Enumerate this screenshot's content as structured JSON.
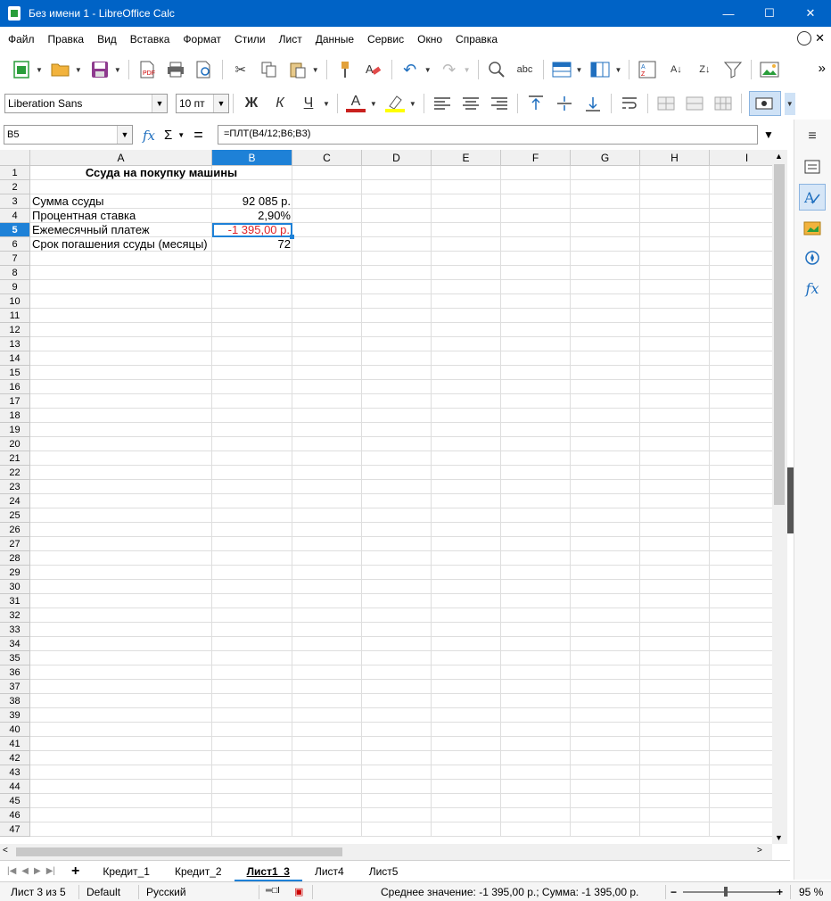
{
  "window": {
    "title": "Без имени 1 - LibreOffice Calc",
    "controls": [
      "—",
      "☐",
      "✕"
    ]
  },
  "menu": [
    "Файл",
    "Правка",
    "Вид",
    "Вставка",
    "Формат",
    "Стили",
    "Лист",
    "Данные",
    "Сервис",
    "Окно",
    "Справка"
  ],
  "format_toolbar": {
    "font_name": "Liberation Sans",
    "font_size": "10 пт",
    "bold": "Ж",
    "italic": "К",
    "underline": "Ч",
    "font_color_glyph": "A"
  },
  "formula_bar": {
    "cell_ref": "B5",
    "formula": "=ПЛТ(B4/12;B6;B3)"
  },
  "columns": [
    "A",
    "B",
    "C",
    "D",
    "E",
    "F",
    "G",
    "H",
    "I"
  ],
  "selected_column": "B",
  "selected_row": "5",
  "cells": {
    "a1": "Ссуда на покупку машины",
    "a3": "Сумма  ссуды",
    "b3": "92 085 р.",
    "a4": "Процентная ставка",
    "b4": "2,90%",
    "a5": "Ежемесячный платеж",
    "b5": "-1 395,00 р.",
    "a6": "Срок погашения ссуды (месяцы)",
    "b6": "72"
  },
  "negative_color": "#e0242b",
  "selection_color": "#1e81d7",
  "sheets": [
    "Кредит_1",
    "Кредит_2",
    "Лист1_3",
    "Лист4",
    "Лист5"
  ],
  "active_sheet": "Лист1_3",
  "status": {
    "sheet_pos": "Лист 3 из 5",
    "page_style": "Default",
    "language": "Русский",
    "summary": "Среднее значение: -1 395,00 р.; Сумма: -1 395,00 р.",
    "zoom": "95 %"
  }
}
